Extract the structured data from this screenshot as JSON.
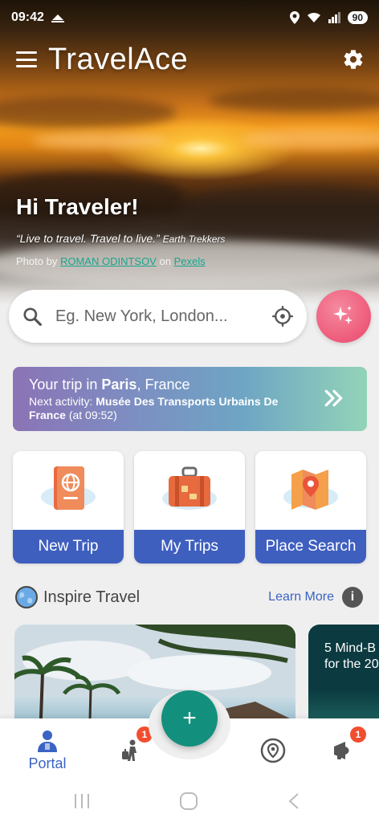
{
  "status_bar": {
    "time": "09:42",
    "battery": "90",
    "icons": [
      "notification-icon",
      "location-icon",
      "wifi-icon",
      "signal-icon",
      "battery-icon"
    ]
  },
  "header": {
    "title": "TravelAce",
    "menu_icon": "menu-icon",
    "settings_icon": "gear-icon"
  },
  "hero": {
    "greeting": "Hi Traveler!",
    "quote": "“Live to travel. Travel to live.”",
    "quote_author": "Earth Trekkers",
    "credit_prefix": "Photo by",
    "photographer": "ROMAN ODINTSOV",
    "credit_on": "on",
    "source": "Pexels"
  },
  "search": {
    "placeholder": "Eg. New York, London...",
    "value": ""
  },
  "trip": {
    "prefix": "Your trip in",
    "city": "Paris",
    "country": ", France",
    "activity_prefix": "Next activity:",
    "activity": "Musée Des Transports Urbains De France",
    "activity_time": "(at 09:52)"
  },
  "actions": [
    {
      "label": "New Trip",
      "icon": "passport-icon"
    },
    {
      "label": "My Trips",
      "icon": "suitcase-icon"
    },
    {
      "label": "Place Search",
      "icon": "map-pin-icon"
    }
  ],
  "inspire": {
    "title": "Inspire Travel",
    "learn_more": "Learn More",
    "info": "i",
    "article_title": "5 Mind-B for the 20"
  },
  "bottom_nav": {
    "portal_label": "Portal",
    "trips_badge": "1",
    "alerts_badge": "1",
    "fab": "+"
  },
  "colors": {
    "accent": "#3f5fbf",
    "teal": "#12907d",
    "pink": "#ee5a79",
    "badge": "#f14e2f"
  }
}
